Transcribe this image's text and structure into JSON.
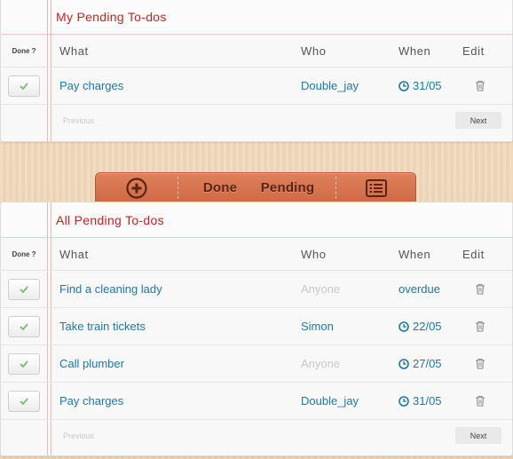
{
  "my_panel": {
    "title": "My Pending To-dos",
    "headers": {
      "done": "Done ?",
      "what": "What",
      "who": "Who",
      "when": "When",
      "edit": "Edit"
    },
    "rows": [
      {
        "what": "Pay charges",
        "who": "Double_jay",
        "when": "31/05",
        "when_icon": "clock-icon",
        "who_muted": false
      }
    ],
    "pager": {
      "previous": "Previous",
      "next": "Next"
    }
  },
  "toolbar": {
    "add_icon": "plus-circle-icon",
    "done_label": "Done",
    "pending_label": "Pending",
    "list_icon": "list-icon",
    "color": "#d5724d"
  },
  "all_panel": {
    "title": "All Pending To-dos",
    "headers": {
      "done": "Done ?",
      "what": "What",
      "who": "Who",
      "when": "When",
      "edit": "Edit"
    },
    "rows": [
      {
        "what": "Find a cleaning lady",
        "who": "Anyone",
        "when": "overdue",
        "when_icon": "",
        "who_muted": true
      },
      {
        "what": "Take train tickets",
        "who": "Simon",
        "when": "22/05",
        "when_icon": "clock-icon",
        "who_muted": false
      },
      {
        "what": "Call plumber",
        "who": "Anyone",
        "when": "27/05",
        "when_icon": "clock-icon",
        "who_muted": true
      },
      {
        "what": "Pay charges",
        "who": "Double_jay",
        "when": "31/05",
        "when_icon": "clock-icon",
        "who_muted": false
      }
    ],
    "pager": {
      "previous": "Previous",
      "next": "Next"
    }
  },
  "colors": {
    "title_red": "#cc2222",
    "link_blue": "#1b78b3",
    "muted_gray": "#c8c8c8",
    "check_green": "#7fc07a"
  }
}
